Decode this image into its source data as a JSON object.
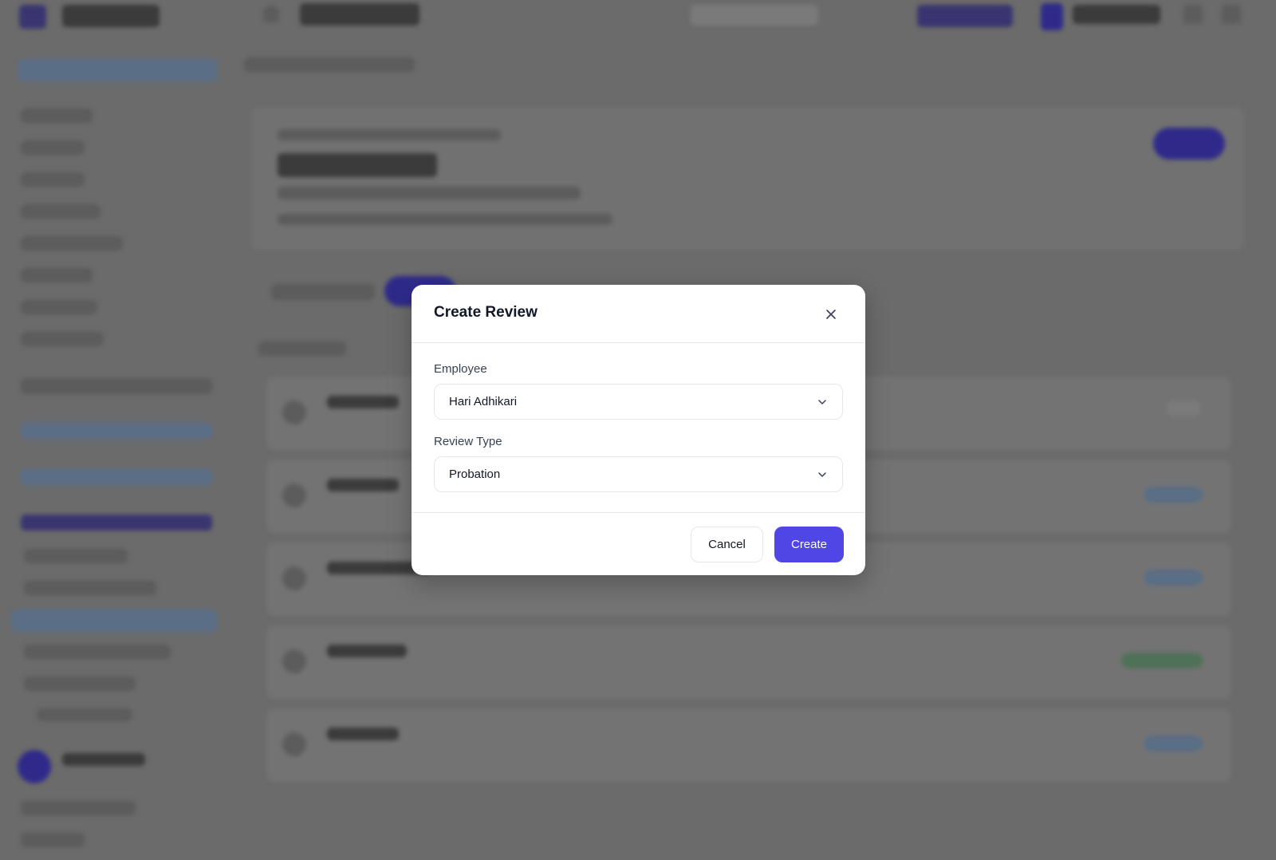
{
  "modal": {
    "title": "Create Review",
    "close_icon": "close-icon",
    "fields": [
      {
        "label": "Employee",
        "value": "Hari Adhikari",
        "icon": "chevron-down-icon"
      },
      {
        "label": "Review Type",
        "value": "Probation",
        "icon": "chevron-down-icon"
      }
    ],
    "cancel_label": "Cancel",
    "create_label": "Create"
  },
  "colors": {
    "accent": "#4f46e5",
    "overlay": "#6b6b6b"
  }
}
